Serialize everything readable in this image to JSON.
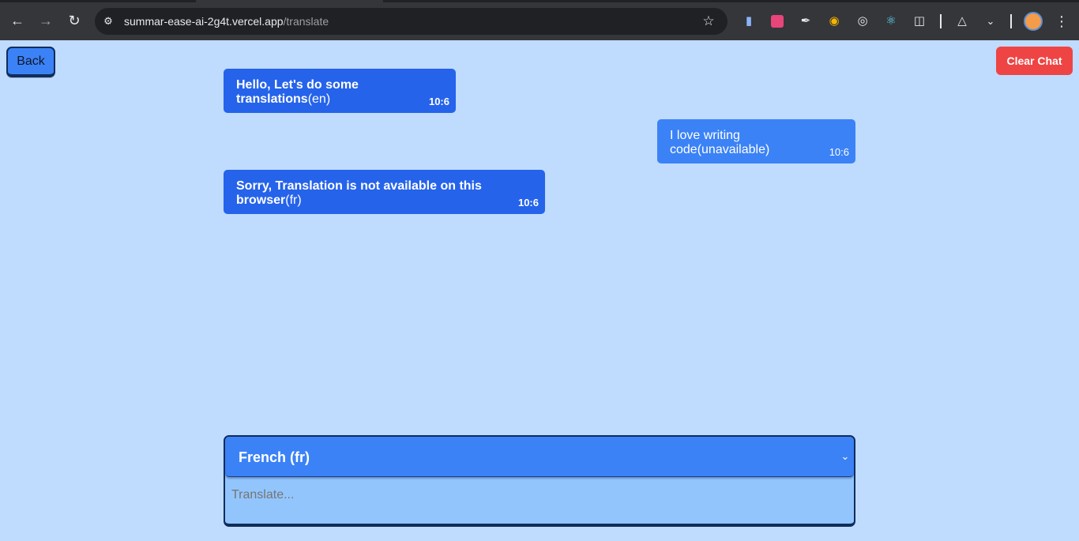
{
  "browser": {
    "url_domain": "summar-ease-ai-2g4t.vercel.app",
    "url_path": "/translate",
    "icons": {
      "back": "back-arrow-icon",
      "forward": "forward-arrow-icon",
      "reload": "reload-icon",
      "site_info": "site-info-icon",
      "bookmark": "star-icon",
      "menu": "kebab-menu-icon"
    },
    "extensions": [
      "docs-icon",
      "calendar-icon",
      "eyedropper-icon",
      "bug-icon",
      "target-icon",
      "react-icon",
      "puzzle-icon",
      "flask-icon",
      "chevron-down-icon"
    ]
  },
  "page": {
    "back_label": "Back",
    "clear_label": "Clear Chat",
    "colors": {
      "background": "#bfdbfe",
      "bot_bubble": "#2563eb",
      "user_bubble": "#3b82f6",
      "clear_button": "#ef4444"
    }
  },
  "messages": [
    {
      "sender": "bot",
      "text": "Hello, Let's do some translations",
      "lang": "(en)",
      "time": "10:6"
    },
    {
      "sender": "user",
      "text": "I love writing code",
      "lang": "(unavailable)",
      "time": "10:6"
    },
    {
      "sender": "bot",
      "text": "Sorry, Translation is not available on this browser",
      "lang": "(fr)",
      "time": "10:6"
    }
  ],
  "composer": {
    "selected_language": "French (fr)",
    "placeholder": "Translate...",
    "value": ""
  }
}
